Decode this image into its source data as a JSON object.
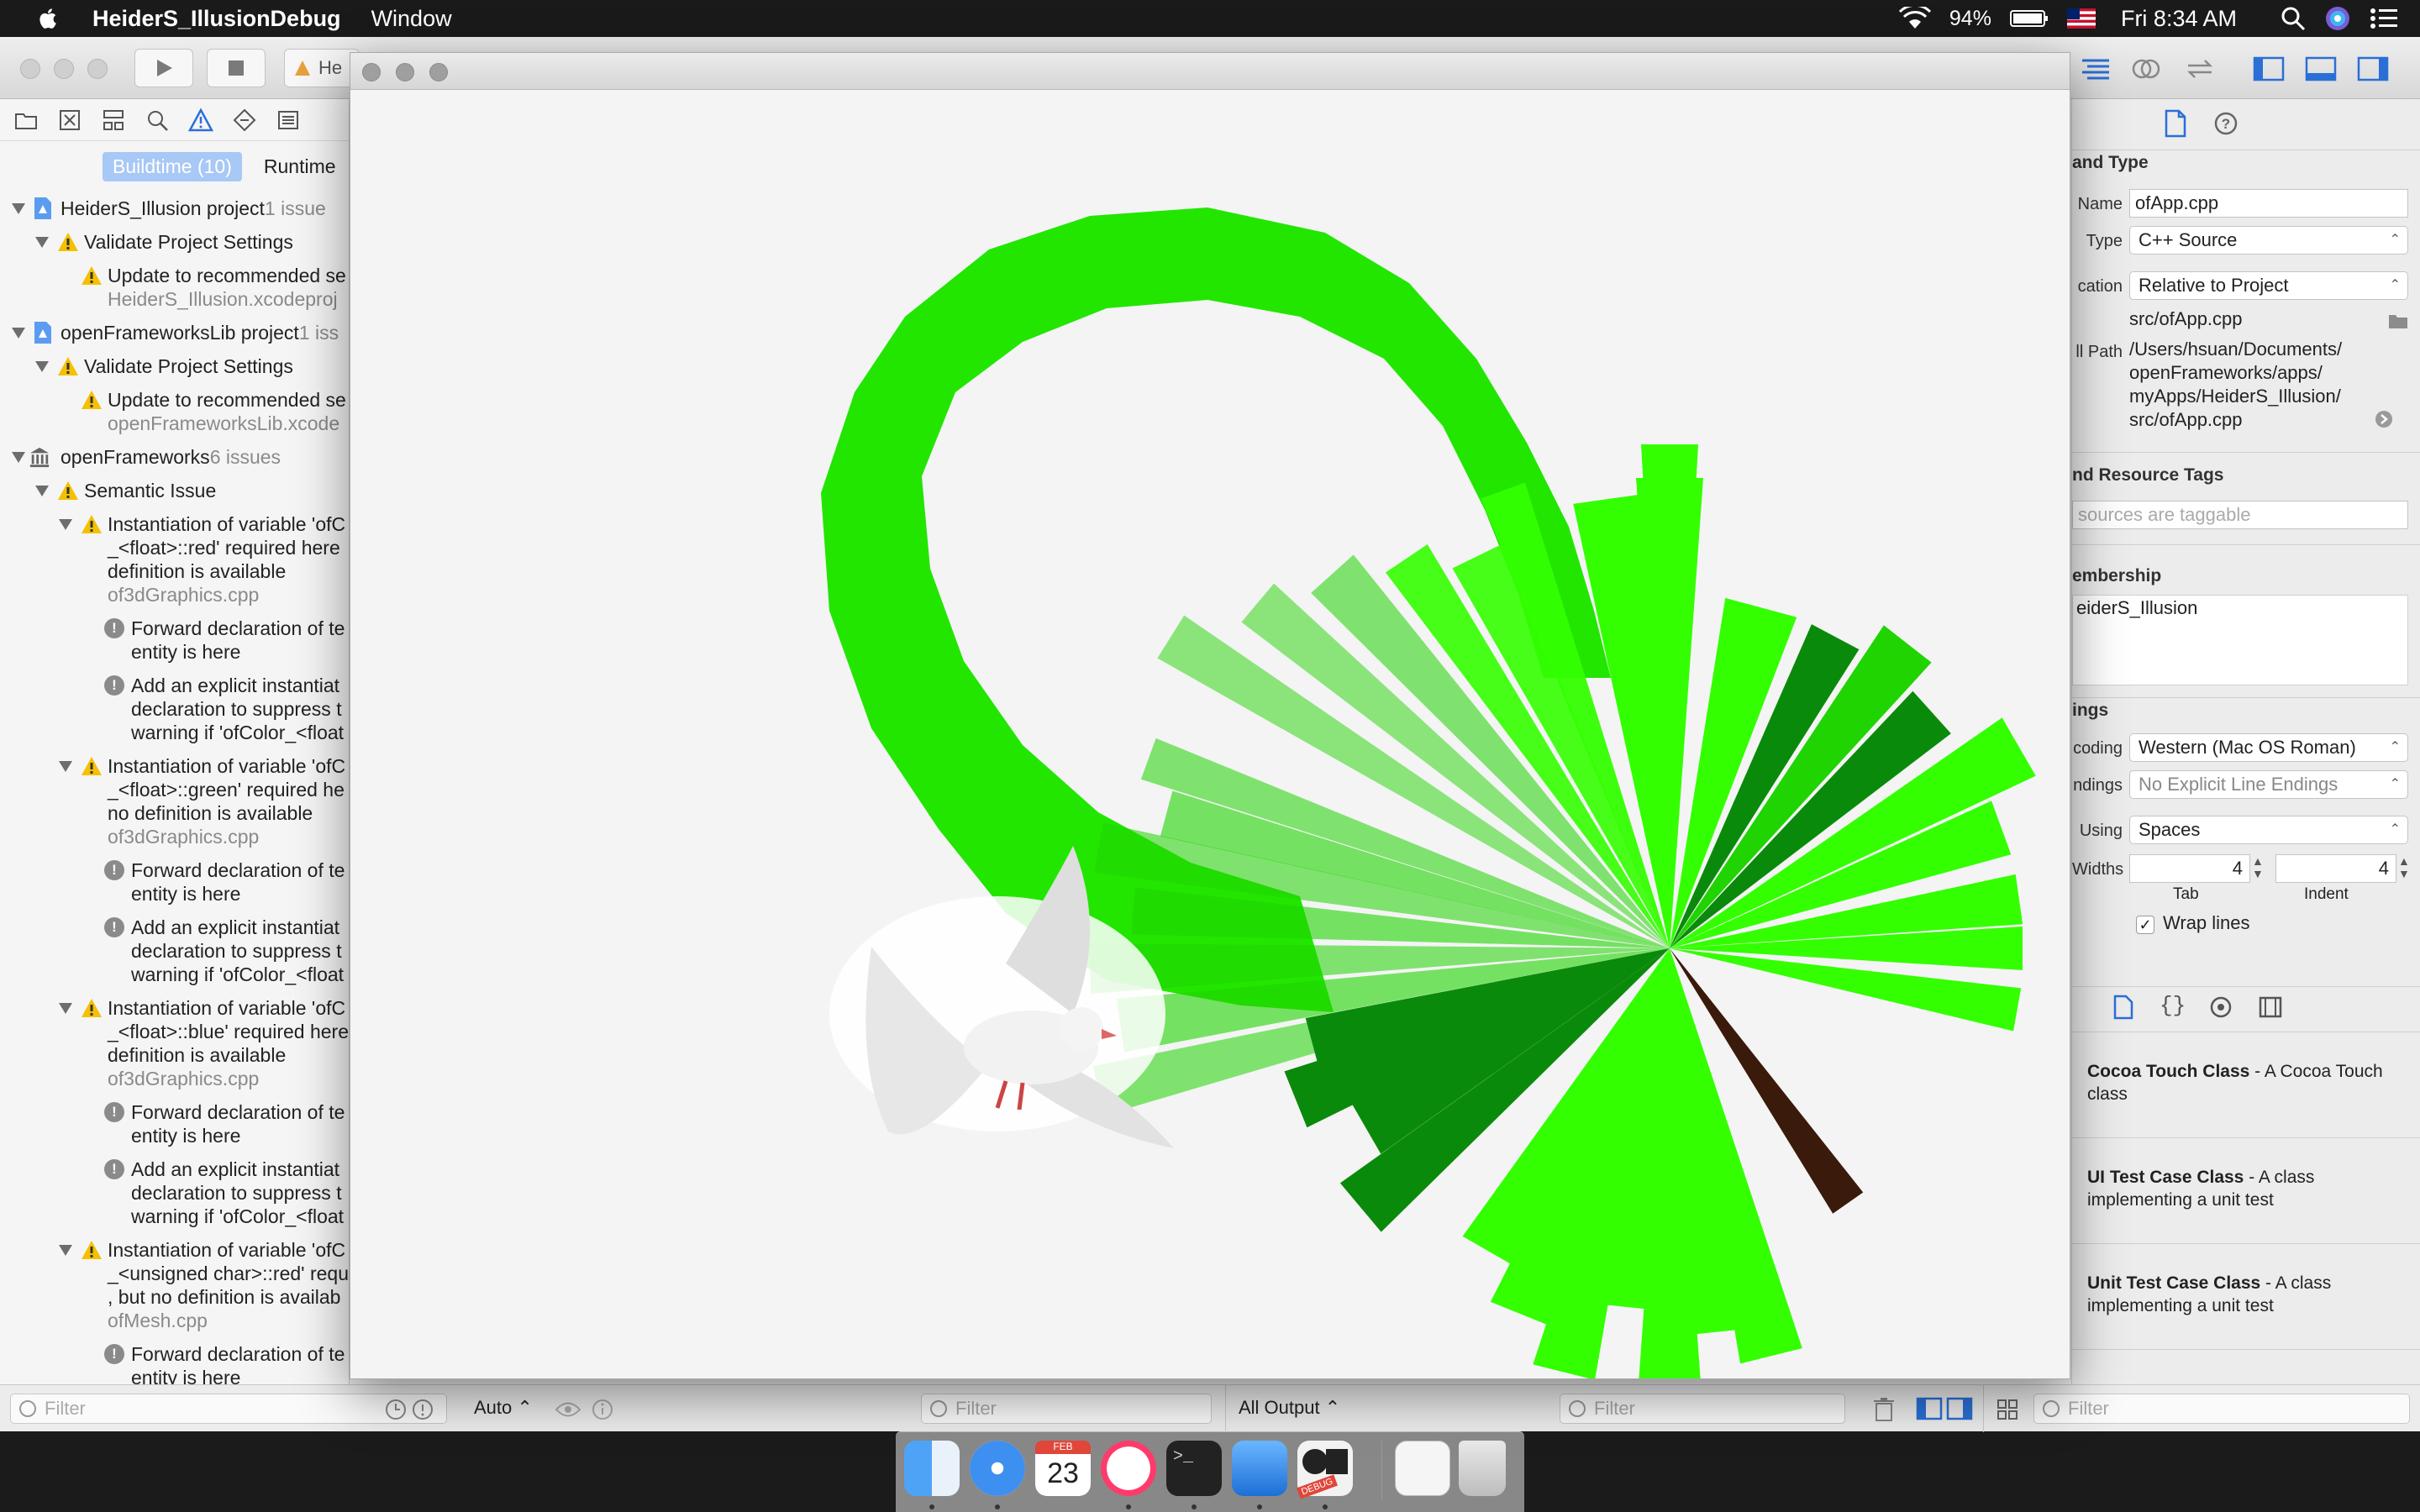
{
  "menubar": {
    "app_name": "HeiderS_IllusionDebug",
    "menus": [
      "Window"
    ],
    "battery": "94%",
    "clock": "Fri 8:34 AM"
  },
  "toolbar": {
    "scheme_label": "He"
  },
  "navigator": {
    "tabs": {
      "buildtime": "Buildtime (10)",
      "runtime": "Runtime"
    },
    "rows": [
      {
        "text": "HeiderS_Illusion project",
        "sub": "1 issue"
      },
      {
        "text": "Validate Project Settings"
      },
      {
        "text": "Update to recommended se"
      },
      {
        "text": "HeiderS_Illusion.xcodeproj"
      },
      {
        "text": "openFrameworksLib project",
        "sub": "1 iss"
      },
      {
        "text": "Validate Project Settings"
      },
      {
        "text": "Update to recommended se"
      },
      {
        "text": "openFrameworksLib.xcode"
      },
      {
        "text": "openFrameworks",
        "sub": "6 issues"
      },
      {
        "text": "Semantic Issue"
      },
      {
        "text": "Instantiation of variable 'ofC"
      },
      {
        "text": "_<float>::red' required here"
      },
      {
        "text": "definition is available"
      },
      {
        "text": "of3dGraphics.cpp"
      },
      {
        "text": "Forward declaration of te"
      },
      {
        "text": "entity is here"
      },
      {
        "text": "Add an explicit instantiat"
      },
      {
        "text": "declaration to suppress t"
      },
      {
        "text": "warning if 'ofColor_<float"
      },
      {
        "text": "Instantiation of variable 'ofC"
      },
      {
        "text": "_<float>::green' required he"
      },
      {
        "text": "no definition is available"
      },
      {
        "text": "of3dGraphics.cpp"
      },
      {
        "text": "Forward declaration of te"
      },
      {
        "text": "entity is here"
      },
      {
        "text": "Add an explicit instantiat"
      },
      {
        "text": "declaration to suppress t"
      },
      {
        "text": "warning if 'ofColor_<float"
      },
      {
        "text": "Instantiation of variable 'ofC"
      },
      {
        "text": "_<float>::blue' required here"
      },
      {
        "text": "definition is available"
      },
      {
        "text": "of3dGraphics.cpp"
      },
      {
        "text": "Forward declaration of te"
      },
      {
        "text": "entity is here"
      },
      {
        "text": "Add an explicit instantiat"
      },
      {
        "text": "declaration to suppress t"
      },
      {
        "text": "warning if 'ofColor_<float"
      },
      {
        "text": "Instantiation of variable 'ofC"
      },
      {
        "text": "_<unsigned char>::red' requ"
      },
      {
        "text": ", but no definition is availab"
      },
      {
        "text": "ofMesh.cpp"
      },
      {
        "text": "Forward declaration of te"
      },
      {
        "text": "entity is here"
      }
    ]
  },
  "inspector": {
    "identity_title": "and Type",
    "name_label": "Name",
    "name_value": "ofApp.cpp",
    "type_label": "Type",
    "type_value": "C++ Source",
    "location_label": "cation",
    "location_value": "Relative to Project",
    "relative_path": "src/ofApp.cpp",
    "fullpath_label": "ll Path",
    "fullpath_lines": [
      "/Users/hsuan/Documents/",
      "openFrameworks/apps/",
      "myApps/HeiderS_Illusion/",
      "src/ofApp.cpp"
    ],
    "tags_title": "nd Resource Tags",
    "tags_placeholder": "sources are taggable",
    "membership_title": "embership",
    "membership_item": "eiderS_Illusion",
    "settings_title": "ings",
    "encoding_label": "coding",
    "encoding_value": "Western (Mac OS Roman)",
    "endings_label": "ndings",
    "endings_value": "No Explicit Line Endings",
    "indent_using_label": "Using",
    "indent_using_value": "Spaces",
    "widths_label": "Widths",
    "tab_value": "4",
    "indent_value": "4",
    "tab_label": "Tab",
    "indent_label": "Indent",
    "wrap_label": "Wrap lines",
    "library": [
      {
        "title": "Cocoa Touch Class",
        "desc": " - A Cocoa Touch class"
      },
      {
        "title": "UI Test Case Class",
        "desc": " - A class implementing a unit test"
      },
      {
        "title": "Unit Test Case Class",
        "desc": " - A class implementing a unit test"
      }
    ]
  },
  "bottombar": {
    "filter_placeholder": "Filter",
    "auto_label": "Auto",
    "output_label": "All Output"
  },
  "dock": {
    "calendar_month": "FEB",
    "calendar_day": "23",
    "debug_badge": "DEBUG"
  },
  "colors": {
    "green_bright": "#33ff00",
    "green_mid": "#1fd400",
    "green_dark": "#0a8a0a",
    "brown": "#3a1a0a"
  }
}
